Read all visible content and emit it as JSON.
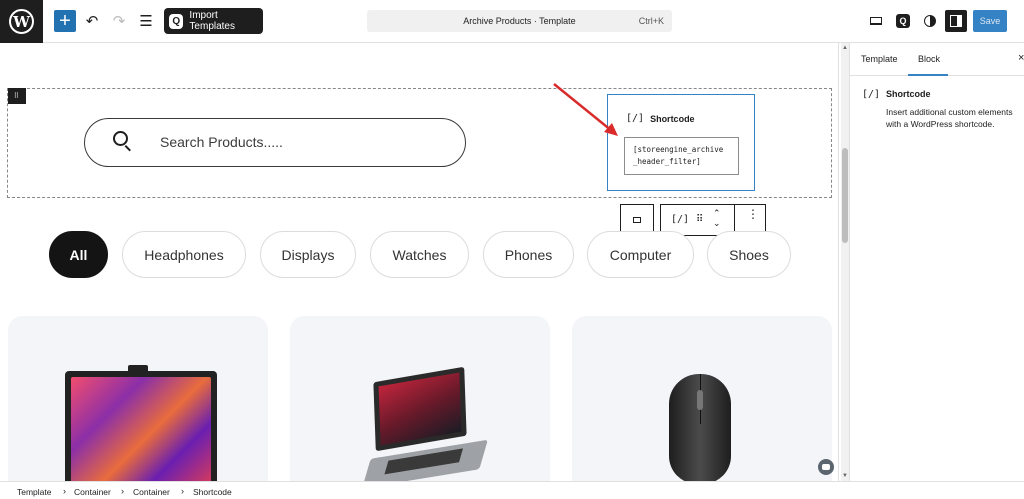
{
  "toolbar": {
    "logo": "W",
    "add_icon": "+",
    "undo_icon": "↶",
    "redo_icon": "↷",
    "list_view_icon": "☰",
    "import_label": "Import Templates",
    "import_icon": "Q",
    "document_title": "Archive Products · Template",
    "shortcut": "Ctrl+K",
    "save_label": "Save"
  },
  "canvas": {
    "search_placeholder": "Search Products.....",
    "shortcode_block": {
      "icon": "[/]",
      "title": "Shortcode",
      "code_line1": "[storeengine_archive",
      "code_line2": "_header_filter]"
    },
    "block_toolbar": {
      "icon": "[/]",
      "grip": "⠿",
      "up": "⌃",
      "down": "⌄",
      "more": "⋮"
    },
    "filters": [
      "All",
      "Headphones",
      "Displays",
      "Watches",
      "Phones",
      "Computer",
      "Shoes"
    ],
    "active_filter": "All"
  },
  "sidebar": {
    "tabs": [
      "Template",
      "Block"
    ],
    "active_tab": "Block",
    "close_icon": "×",
    "block_icon": "[/]",
    "block_name": "Shortcode",
    "block_description": "Insert additional custom elements with a WordPress shortcode."
  },
  "footer": {
    "breadcrumb": [
      "Template",
      "Container",
      "Container",
      "Shortcode"
    ],
    "separator": "›"
  },
  "colors": {
    "accent": "#3582c4",
    "dark": "#1e1e1e",
    "arrow": "#d92b2b"
  }
}
